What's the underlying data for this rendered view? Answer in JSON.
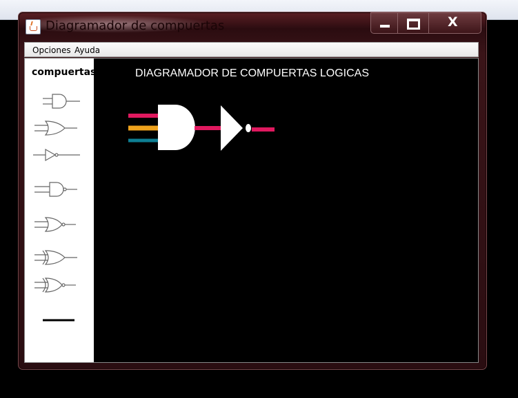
{
  "window": {
    "title": "Diagramador de compuertas"
  },
  "menu": [
    "Opciones",
    "Ayuda"
  ],
  "sidebar": {
    "title": "compuertas",
    "tools": [
      "and-gate-icon",
      "or-gate-icon",
      "not-gate-icon",
      "nand-gate-icon",
      "nor-gate-icon",
      "xor-gate-icon",
      "xnor-gate-icon",
      "wire-icon"
    ]
  },
  "canvas": {
    "title": "DIAGRAMADOR DE COMPUERTAS LOGICAS",
    "wire_colors": {
      "input1": "#e0195f",
      "input2": "#efa21c",
      "input3": "#0e7f93",
      "output": "#e0195f"
    },
    "gates": [
      "and-gate",
      "not-gate"
    ]
  }
}
